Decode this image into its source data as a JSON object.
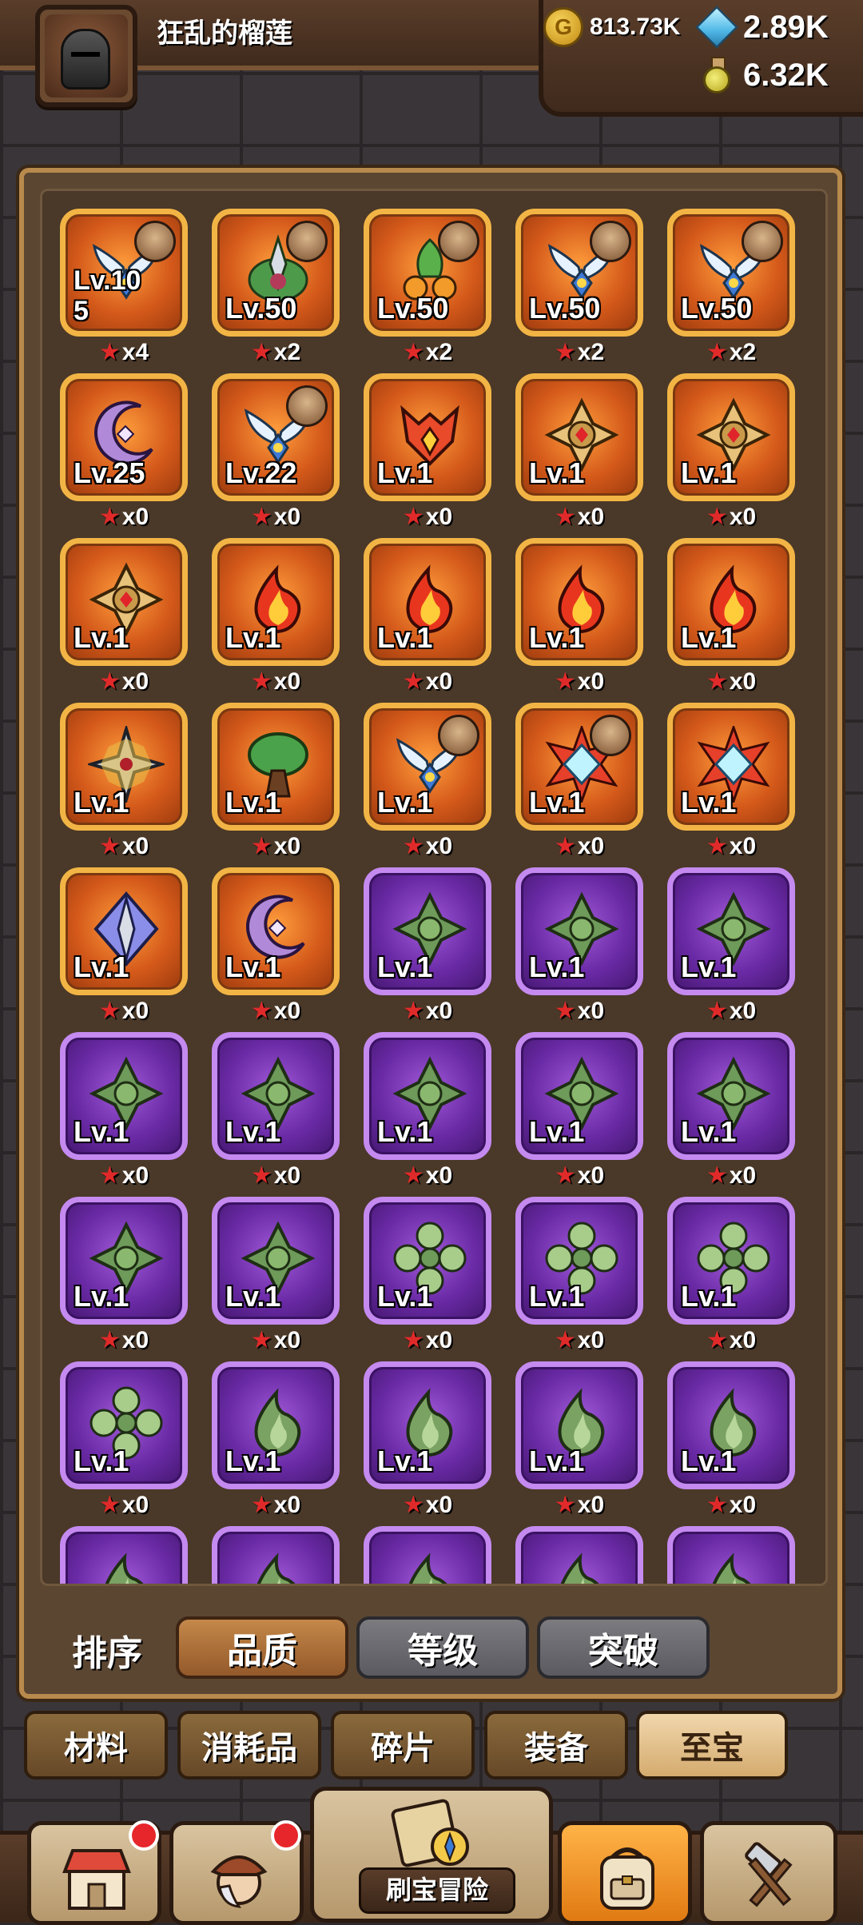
{
  "player": {
    "name": "狂乱的榴莲"
  },
  "resources": {
    "gold": "813.73K",
    "gems": "2.89K",
    "potion": "6.32K"
  },
  "items": [
    {
      "level": "Lv.10\n5",
      "stars": "x4",
      "rarity": "orange",
      "icon": "wings-icon",
      "hero": true
    },
    {
      "level": "Lv.50",
      "stars": "x2",
      "rarity": "orange",
      "icon": "leaf-sword-icon",
      "hero": true
    },
    {
      "level": "Lv.50",
      "stars": "x2",
      "rarity": "orange",
      "icon": "plant-pot-icon",
      "hero": true
    },
    {
      "level": "Lv.50",
      "stars": "x2",
      "rarity": "orange",
      "icon": "wings-icon",
      "hero": true
    },
    {
      "level": "Lv.50",
      "stars": "x2",
      "rarity": "orange",
      "icon": "wings-icon",
      "hero": true
    },
    {
      "level": "Lv.25",
      "stars": "x0",
      "rarity": "orange",
      "icon": "crescent-icon",
      "hero": false
    },
    {
      "level": "Lv.22",
      "stars": "x0",
      "rarity": "orange",
      "icon": "wings-icon",
      "hero": true
    },
    {
      "level": "Lv.1",
      "stars": "x0",
      "rarity": "orange",
      "icon": "demon-mask-icon",
      "hero": false
    },
    {
      "level": "Lv.1",
      "stars": "x0",
      "rarity": "orange",
      "icon": "cross-shield-icon",
      "hero": false
    },
    {
      "level": "Lv.1",
      "stars": "x0",
      "rarity": "orange",
      "icon": "cross-shield-icon",
      "hero": false
    },
    {
      "level": "Lv.1",
      "stars": "x0",
      "rarity": "orange",
      "icon": "cross-shield-icon",
      "hero": false
    },
    {
      "level": "Lv.1",
      "stars": "x0",
      "rarity": "orange",
      "icon": "flame-icon",
      "hero": false
    },
    {
      "level": "Lv.1",
      "stars": "x0",
      "rarity": "orange",
      "icon": "flame-icon",
      "hero": false
    },
    {
      "level": "Lv.1",
      "stars": "x0",
      "rarity": "orange",
      "icon": "flame-icon",
      "hero": false
    },
    {
      "level": "Lv.1",
      "stars": "x0",
      "rarity": "orange",
      "icon": "flame-icon",
      "hero": false
    },
    {
      "level": "Lv.1",
      "stars": "x0",
      "rarity": "orange",
      "icon": "shuriken-icon",
      "hero": false
    },
    {
      "level": "Lv.1",
      "stars": "x0",
      "rarity": "orange",
      "icon": "tree-icon",
      "hero": false
    },
    {
      "level": "Lv.1",
      "stars": "x0",
      "rarity": "orange",
      "icon": "wings-icon",
      "hero": true
    },
    {
      "level": "Lv.1",
      "stars": "x0",
      "rarity": "orange",
      "icon": "diamond-star-icon",
      "hero": true
    },
    {
      "level": "Lv.1",
      "stars": "x0",
      "rarity": "orange",
      "icon": "diamond-star-icon",
      "hero": false
    },
    {
      "level": "Lv.1",
      "stars": "x0",
      "rarity": "orange",
      "icon": "spear-diamond-icon",
      "hero": false
    },
    {
      "level": "Lv.1",
      "stars": "x0",
      "rarity": "orange",
      "icon": "crescent-icon",
      "hero": false
    },
    {
      "level": "Lv.1",
      "stars": "x0",
      "rarity": "purple",
      "icon": "green-clover-icon",
      "hero": false
    },
    {
      "level": "Lv.1",
      "stars": "x0",
      "rarity": "purple",
      "icon": "green-clover-icon",
      "hero": false
    },
    {
      "level": "Lv.1",
      "stars": "x0",
      "rarity": "purple",
      "icon": "green-clover-icon",
      "hero": false
    },
    {
      "level": "Lv.1",
      "stars": "x0",
      "rarity": "purple",
      "icon": "green-clover-icon",
      "hero": false
    },
    {
      "level": "Lv.1",
      "stars": "x0",
      "rarity": "purple",
      "icon": "green-clover-icon",
      "hero": false
    },
    {
      "level": "Lv.1",
      "stars": "x0",
      "rarity": "purple",
      "icon": "green-clover-icon",
      "hero": false
    },
    {
      "level": "Lv.1",
      "stars": "x0",
      "rarity": "purple",
      "icon": "green-clover-icon",
      "hero": false
    },
    {
      "level": "Lv.1",
      "stars": "x0",
      "rarity": "purple",
      "icon": "green-clover-icon",
      "hero": false
    },
    {
      "level": "Lv.1",
      "stars": "x0",
      "rarity": "purple",
      "icon": "green-clover-icon",
      "hero": false
    },
    {
      "level": "Lv.1",
      "stars": "x0",
      "rarity": "purple",
      "icon": "green-clover-icon",
      "hero": false
    },
    {
      "level": "Lv.1",
      "stars": "x0",
      "rarity": "purple",
      "icon": "green-flower-icon",
      "hero": false
    },
    {
      "level": "Lv.1",
      "stars": "x0",
      "rarity": "purple",
      "icon": "green-flower-icon",
      "hero": false
    },
    {
      "level": "Lv.1",
      "stars": "x0",
      "rarity": "purple",
      "icon": "green-flower-icon",
      "hero": false
    },
    {
      "level": "Lv.1",
      "stars": "x0",
      "rarity": "purple",
      "icon": "green-flower-icon",
      "hero": false
    },
    {
      "level": "Lv.1",
      "stars": "x0",
      "rarity": "purple",
      "icon": "green-flame-icon",
      "hero": false
    },
    {
      "level": "Lv.1",
      "stars": "x0",
      "rarity": "purple",
      "icon": "green-flame-icon",
      "hero": false
    },
    {
      "level": "Lv.1",
      "stars": "x0",
      "rarity": "purple",
      "icon": "green-flame-icon",
      "hero": false
    },
    {
      "level": "Lv.1",
      "stars": "x0",
      "rarity": "purple",
      "icon": "green-flame-icon",
      "hero": false
    },
    {
      "level": "",
      "stars": "",
      "rarity": "purple",
      "icon": "green-flame-icon",
      "hero": false
    },
    {
      "level": "",
      "stars": "",
      "rarity": "purple",
      "icon": "green-flame-icon",
      "hero": false
    },
    {
      "level": "",
      "stars": "",
      "rarity": "purple",
      "icon": "green-flame-icon",
      "hero": false
    },
    {
      "level": "",
      "stars": "",
      "rarity": "purple",
      "icon": "green-flame-icon",
      "hero": false
    },
    {
      "level": "",
      "stars": "",
      "rarity": "purple",
      "icon": "green-flame-icon",
      "hero": false
    }
  ],
  "sort": {
    "label": "排序",
    "options": [
      "品质",
      "等级",
      "突破"
    ],
    "active_index": 0
  },
  "categories": {
    "tabs": [
      "材料",
      "消耗品",
      "碎片",
      "装备",
      "至宝"
    ],
    "active_index": 4
  },
  "nav": {
    "adventure_label": "刷宝冒险",
    "items": [
      {
        "icon": "shop-icon",
        "badge": true
      },
      {
        "icon": "hero-icon",
        "badge": true
      },
      {
        "icon": "adventure-map-icon",
        "badge": false
      },
      {
        "icon": "backpack-icon",
        "badge": false,
        "active": true
      },
      {
        "icon": "forge-icon",
        "badge": false
      }
    ]
  },
  "colors": {
    "orange_rarity": "#d4591a",
    "purple_rarity": "#6a2aa6",
    "active_tab": "#f1d7ac",
    "badge_red": "#e6262a"
  }
}
